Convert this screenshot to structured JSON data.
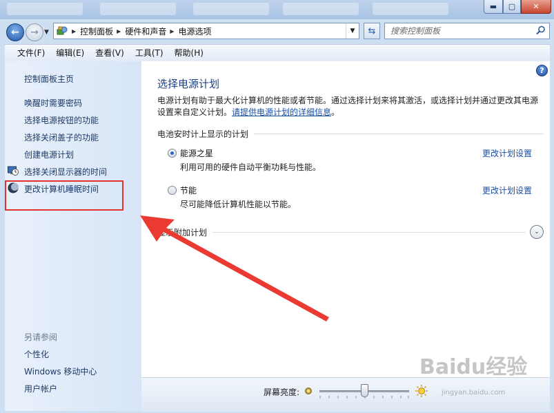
{
  "window": {
    "controls": {
      "minimize": "▬",
      "maximize": "▢",
      "close": "✕"
    }
  },
  "address": {
    "breadcrumbs": [
      "控制面板",
      "硬件和声音",
      "电源选项"
    ],
    "icon": "control-panel-icon"
  },
  "search": {
    "placeholder": "搜索控制面板"
  },
  "menu": [
    "文件(F)",
    "编辑(E)",
    "查看(V)",
    "工具(T)",
    "帮助(H)"
  ],
  "sidebar": {
    "home": "控制面板主页",
    "items": [
      {
        "label": "唤醒时需要密码",
        "icon": ""
      },
      {
        "label": "选择电源按钮的功能",
        "icon": ""
      },
      {
        "label": "选择关闭盖子的功能",
        "icon": ""
      },
      {
        "label": "创建电源计划",
        "icon": ""
      },
      {
        "label": "选择关闭显示器的时间",
        "icon": "monitor-clock-icon"
      },
      {
        "label": "更改计算机睡眠时间",
        "icon": "moon-icon"
      }
    ],
    "see_also_title": "另请参阅",
    "see_also": [
      "个性化",
      "Windows 移动中心",
      "用户帐户"
    ]
  },
  "main": {
    "title": "选择电源计划",
    "description": "电源计划有助于最大化计算机的性能或者节能。通过选择计划来将其激活，或选择计划并通过更改其电源设置来自定义计划。",
    "description_link": "请提供电源计划的详细信息",
    "description_end": "。",
    "section_title": "电池安时计上显示的计划",
    "plans": [
      {
        "name": "能源之星",
        "desc": "利用可用的硬件自动平衡功耗与性能。",
        "link": "更改计划设置",
        "selected": true
      },
      {
        "name": "节能",
        "desc": "尽可能降低计算机性能以节能。",
        "link": "更改计划设置",
        "selected": false
      }
    ],
    "more_plans": "显示附加计划",
    "help": "?"
  },
  "bottom": {
    "brightness_label": "屏幕亮度:",
    "brightness_level": 0.5
  },
  "watermark": {
    "text": "Baidu经验",
    "sub": "jingyan.baidu.com"
  },
  "colors": {
    "annotation": "#e3312d",
    "link": "#1a4ea6",
    "title": "#1d3f86"
  }
}
